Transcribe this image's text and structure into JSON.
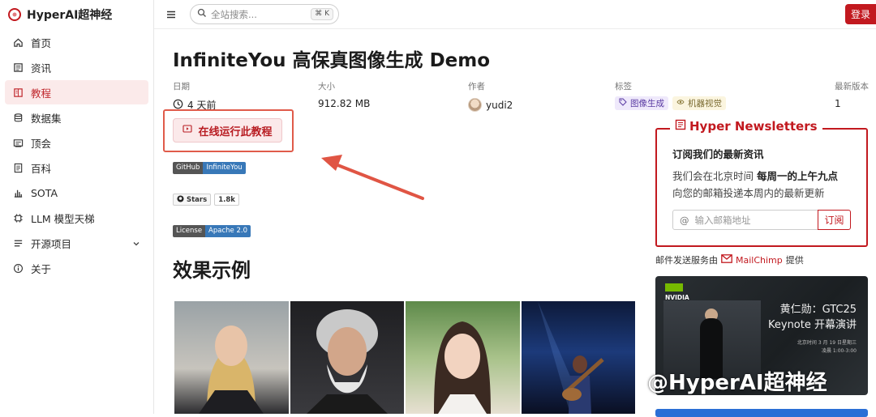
{
  "brand": {
    "name": "HyperAI超神经"
  },
  "sidebar": {
    "items": [
      {
        "label": "首页",
        "icon": "home-icon"
      },
      {
        "label": "资讯",
        "icon": "news-icon"
      },
      {
        "label": "教程",
        "icon": "book-icon",
        "active": true
      },
      {
        "label": "数据集",
        "icon": "database-icon"
      },
      {
        "label": "顶会",
        "icon": "calendar-icon"
      },
      {
        "label": "百科",
        "icon": "wiki-icon"
      },
      {
        "label": "SOTA",
        "icon": "chart-icon"
      },
      {
        "label": "LLM 模型天梯",
        "icon": "chip-icon"
      },
      {
        "label": "开源项目",
        "icon": "list-icon"
      },
      {
        "label": "关于",
        "icon": "info-icon"
      }
    ]
  },
  "topbar": {
    "search_placeholder": "全站搜索...",
    "shortcut": "⌘ K",
    "login_label": "登录"
  },
  "page": {
    "title": "InfiniteYou 高保真图像生成 Demo",
    "meta": {
      "date_label": "日期",
      "date_value": "4 天前",
      "size_label": "大小",
      "size_value": "912.82 MB",
      "author_label": "作者",
      "author_value": "yudi2",
      "tags_label": "标签",
      "tag1": "图像生成",
      "tag2": "机器视觉",
      "version_label": "最新版本",
      "version_value": "1"
    },
    "run_button": "在线运行此教程",
    "badges": {
      "github_left": "GitHub",
      "github_right": "InfiniteYou",
      "stars_label": "Stars",
      "stars_count": "1.8k",
      "license_left": "License",
      "license_right": "Apache 2.0"
    },
    "section_title": "效果示例"
  },
  "newsletter": {
    "heading": "Hyper Newsletters",
    "subtitle": "订阅我们的最新资讯",
    "line1_prefix": "我们会在北京时间 ",
    "line1_bold": "每周一的上午九点",
    "line2": "向您的邮箱投递本周内的最新更新",
    "email_placeholder": "输入邮箱地址",
    "subscribe_label": "订阅",
    "service_prefix": "邮件发送服务由",
    "service_name": "MailChimp",
    "service_suffix": "提供"
  },
  "promo": {
    "brand": "NVIDIA",
    "title_line1": "黄仁勋：GTC25",
    "title_line2": "Keynote 开幕演讲",
    "small_line1": "北京时间 3 月 19 日星期三",
    "small_line2": "凌晨 1:00-3:00"
  },
  "watermark": "@HyperAI超神经",
  "colors": {
    "accent": "#c2191f",
    "active_bg": "#fbeaea"
  }
}
